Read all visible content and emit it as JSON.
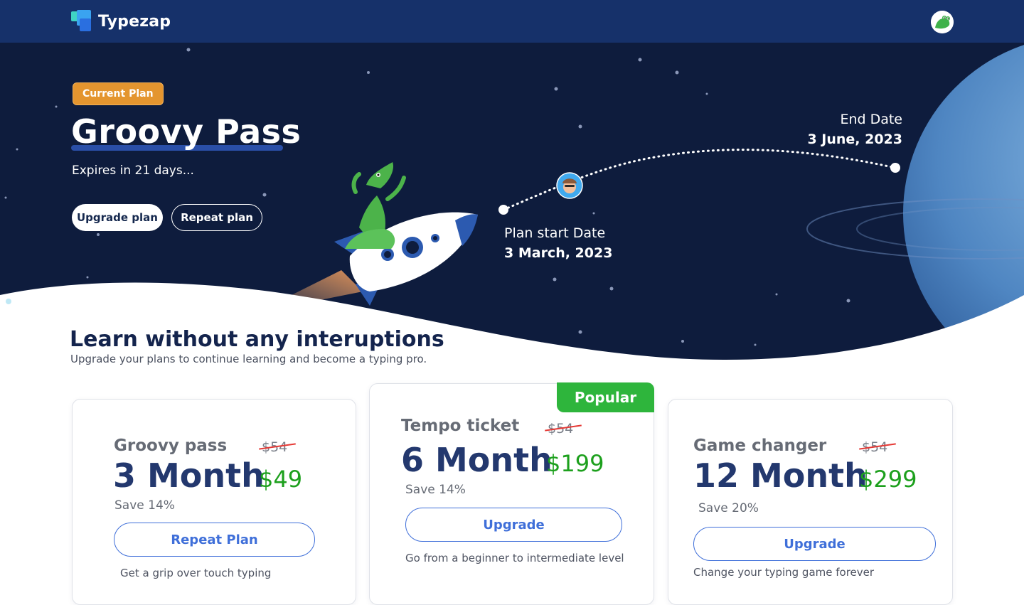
{
  "app": {
    "name": "Typezap"
  },
  "hero": {
    "badge": "Current Plan",
    "plan_name": "Groovy Pass",
    "expires": "Expires in 21 days...",
    "upgrade_label": "Upgrade plan",
    "repeat_label": "Repeat plan",
    "start_label": "Plan start Date",
    "start_date": "3 March, 2023",
    "end_label": "End Date",
    "end_date": "3 June, 2023"
  },
  "section": {
    "title": "Learn without any interuptions",
    "subtitle": "Upgrade your plans to continue learning and become a typing pro."
  },
  "plans": [
    {
      "name": "Groovy pass",
      "old_price": "$54",
      "duration": "3 Month",
      "price": "$49",
      "save": "Save 14%",
      "button": "Repeat Plan",
      "description": "Get a grip over touch typing"
    },
    {
      "name": "Tempo ticket",
      "old_price": "$54",
      "duration": "6 Month",
      "price": "$199",
      "save": "Save 14%",
      "button": "Upgrade",
      "description": "Go from a beginner to intermediate level",
      "tag": "Popular"
    },
    {
      "name": "Game changer",
      "old_price": "$54",
      "duration": "12 Month",
      "price": "$299",
      "save": "Save 20%",
      "button": "Upgrade",
      "description": "Change your typing game forever"
    }
  ],
  "colors": {
    "header": "#16316a",
    "hero_bg": "#0e1c3d",
    "badge": "#e4952f",
    "accent_blue": "#3f6fd9",
    "price_green": "#1da01d",
    "popular_green": "#2eb53c"
  },
  "icons": [
    "typezap-logo-icon",
    "crocodile-avatar-icon",
    "rocket-crocodile-illustration",
    "planet-illustration",
    "user-progress-avatar-icon"
  ]
}
